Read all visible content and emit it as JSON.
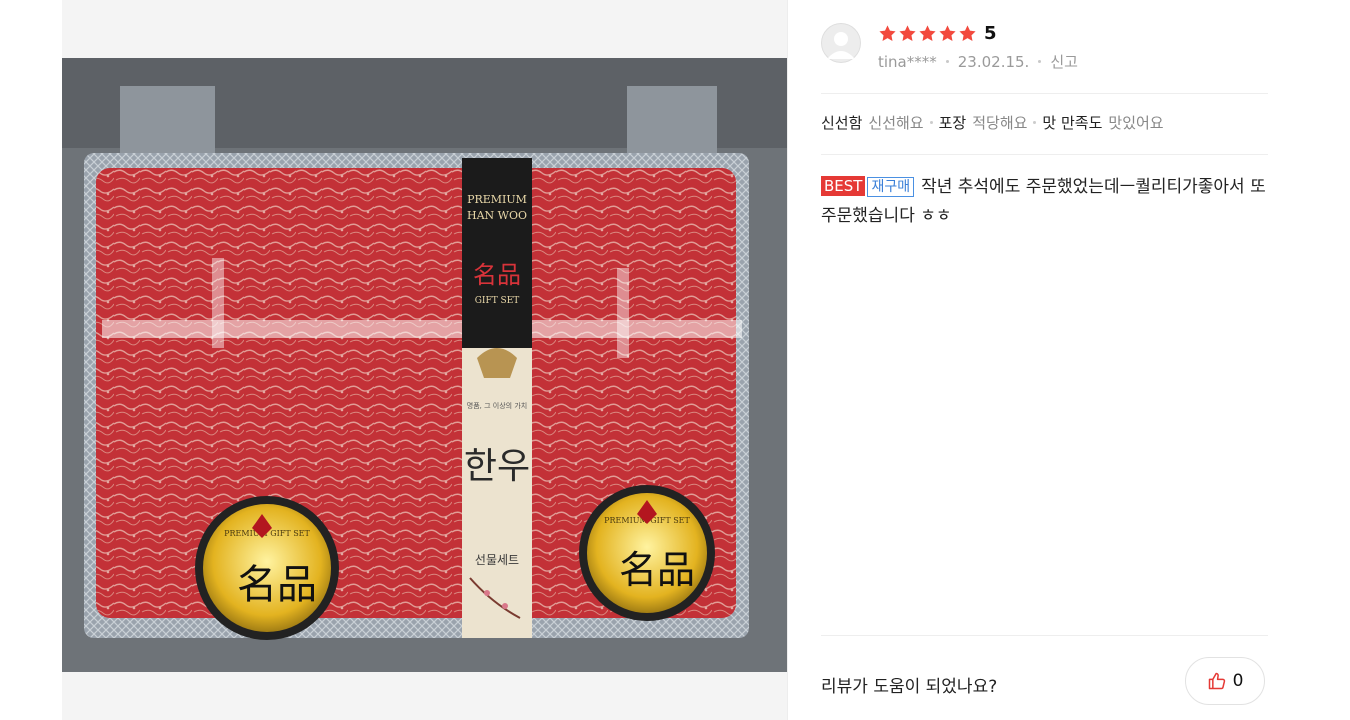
{
  "photo": {
    "label_top_line1": "PREMIUM",
    "label_top_line2": "HAN WOO",
    "label_hanja": "名品",
    "label_gift_set": "GIFT SET",
    "label_poem": "명품, 그 이상의 가치",
    "label_hanwoo": "한우",
    "label_sub": "선물세트",
    "seal_title": "PREMIUM GIFT SET",
    "seal_hanja": "名品"
  },
  "review": {
    "rating": "5",
    "author": "tina****",
    "date": "23.02.15.",
    "report_label": "신고",
    "attributes": [
      {
        "key": "신선함",
        "value": "신선해요"
      },
      {
        "key": "포장",
        "value": "적당해요"
      },
      {
        "key": "맛 만족도",
        "value": "맛있어요"
      }
    ],
    "badge_best": "BEST",
    "badge_rebuy": "재구매",
    "content": "작년 추석에도 주문했었는데ㅡ퀄리티가좋아서 또 주문했습니다 ㅎㅎ",
    "helpful_question": "리뷰가 도움이 되었나요?",
    "helpful_count": "0"
  },
  "colors": {
    "star": "#f24a3e",
    "best_badge": "#e53935",
    "rebuy_badge": "#3b80d8"
  },
  "icons": [
    "avatar-placeholder-icon",
    "star-icon",
    "thumbs-up-icon"
  ]
}
